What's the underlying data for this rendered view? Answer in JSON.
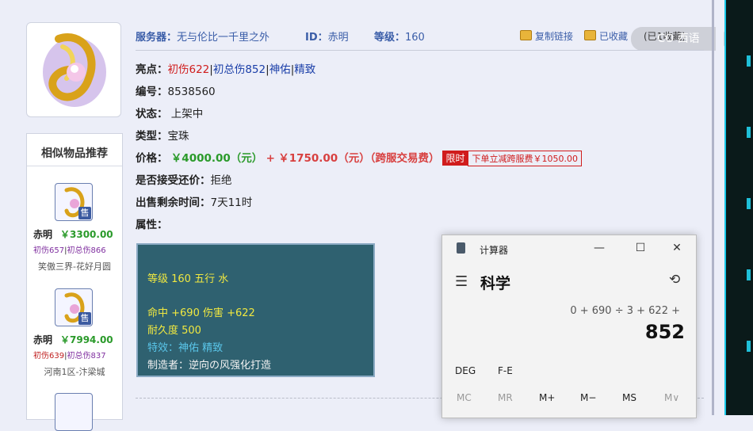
{
  "item": {
    "server_label": "服务器：",
    "server_value": "无与伦比一千里之外",
    "id_label": "ID：",
    "id_value": "赤明",
    "level_label": "等级：",
    "level_value": "160"
  },
  "actions": {
    "copy_link": "复制链接",
    "favorited": "已收藏",
    "cut_text": "(已1收藏)"
  },
  "watermark": "CO 西语",
  "fields": {
    "highlight_label": "亮点：",
    "highlight_1": "初伤622",
    "highlight_2": "初总伤852",
    "highlight_3": "神佑",
    "highlight_4": "精致",
    "serial_label": "编号：",
    "serial_value": "8538560",
    "status_label": "状态：",
    "status_value": "上架中",
    "type_label": "类型：",
    "type_value": "宝珠",
    "price_label": "价格：",
    "price_main": "￥4000.00（元）",
    "price_plus": "+",
    "price_fee": "￥1750.00（元）（跨服交易费）",
    "limited_badge": "限时",
    "limited_note": "下单立减跨服费￥1050.00",
    "bargain_label": "是否接受还价：",
    "bargain_value": "拒绝",
    "remaining_label": "出售剩余时间：",
    "remaining_value": "7天11时",
    "attr_label": "属性："
  },
  "attributes": {
    "line1": "等级 160 五行 水",
    "line2": "命中 +690 伤害 +622",
    "line3": "耐久度 500",
    "line4": "特效：神佑 精致",
    "line5": "制造者：逆向の风强化打造"
  },
  "similar": {
    "title": "相似物品推荐",
    "items": [
      {
        "seller": "赤明",
        "price": "￥3300.00",
        "hi_1": "初伤657",
        "hi_2": "初总伤866",
        "server": "笑傲三界-花好月圆",
        "badge": "售"
      },
      {
        "seller": "赤明",
        "price": "￥7994.00",
        "hi_1": "初伤639",
        "hi_2": "初总伤837",
        "server": "河南1区-汴梁城",
        "badge": "售"
      }
    ]
  },
  "calculator": {
    "title": "计算器",
    "mode": "科学",
    "expression": "0 + 690 ÷ 3 + 622 +",
    "result": "852",
    "deg": "DEG",
    "fe": "F-E",
    "mem_keys": [
      "MC",
      "MR",
      "M+",
      "M−",
      "MS",
      "M∨"
    ]
  },
  "colors": {
    "accent_blue": "#3a5da8",
    "highlight_red": "#d01c1c",
    "price_green": "#2a9a2a",
    "panel_bg": "#2f6170"
  }
}
